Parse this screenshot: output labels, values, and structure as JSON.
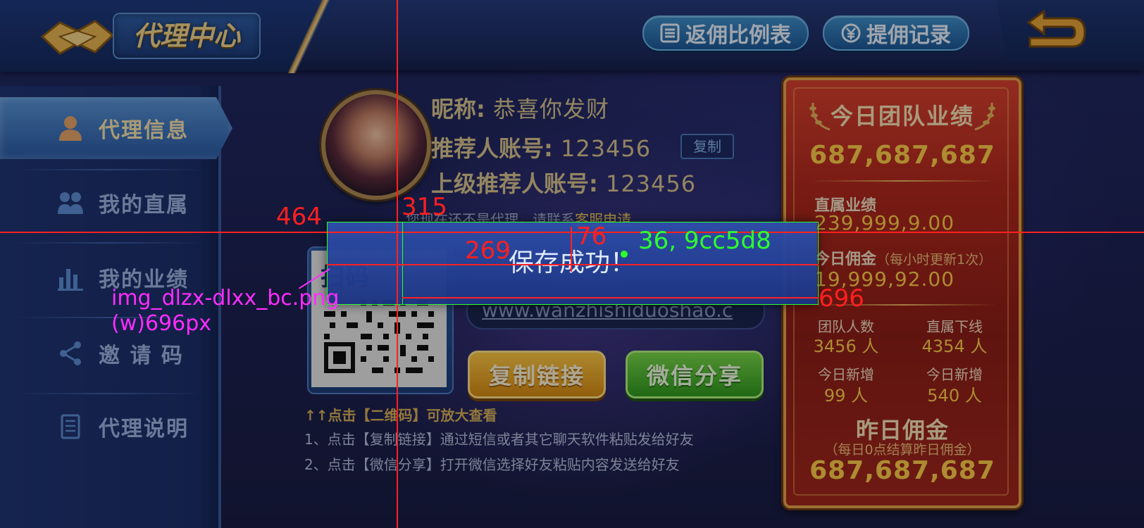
{
  "header": {
    "title": "代理中心",
    "buttons": [
      {
        "label": "返佣比例表",
        "icon": "list-icon"
      },
      {
        "label": "提佣记录",
        "icon": "yen-circle-icon"
      }
    ],
    "back_icon": "back-arrow-icon"
  },
  "sidebar": {
    "items": [
      {
        "label": "代理信息",
        "icon": "person-icon",
        "active": true
      },
      {
        "label": "我的直属",
        "icon": "group-icon",
        "active": false
      },
      {
        "label": "我的业绩",
        "icon": "bar-chart-icon",
        "active": false
      },
      {
        "label": "邀 请 码",
        "icon": "share-icon",
        "active": false
      },
      {
        "label": "代理说明",
        "icon": "document-icon",
        "active": false
      }
    ]
  },
  "profile": {
    "nickname_label": "昵称:",
    "nickname": "恭喜你发财",
    "referrer_label": "推荐人账号:",
    "referrer": "123456",
    "copy_label": "复制",
    "parent_label": "上级推荐人账号:",
    "parent": "123456"
  },
  "notice": {
    "text": "您现在还不是代理，请联系",
    "link": "客服申请"
  },
  "share": {
    "qr_label": "扫码",
    "url": "www.wanzhishiduoshao.c",
    "copy_link_label": "复制链接",
    "wechat_label": "微信分享",
    "hint_title": "↑↑点击【二维码】可放大查看",
    "hint_1": "1、点击【复制链接】通过短信或者其它聊天软件粘贴发给好友",
    "hint_2": "2、点击【微信分享】打开微信选择好友粘贴内容发送给好友"
  },
  "stats": {
    "team_title": "今日团队业绩",
    "team_value": "687,687,687",
    "direct_label": "直属业绩",
    "direct_value": "239,999,9.00",
    "commission_label": "今日佣金",
    "commission_note": "（每小时更新1次）",
    "commission_value": "19,999,92.00",
    "team_count_label": "团队人数",
    "team_count_value": "3456 人",
    "direct_down_label": "直属下线",
    "direct_down_value": "4354 人",
    "new_today_label_1": "今日新增",
    "new_today_value_1": "99 人",
    "new_today_label_2": "今日新增",
    "new_today_value_2": "540 人",
    "yesterday_title": "昨日佣金",
    "yesterday_note": "（每日0点结算昨日佣金）",
    "yesterday_value": "687,687,687"
  },
  "toast": {
    "text": "保存成功！"
  },
  "annotations": {
    "left": "464",
    "top": "315",
    "inner_x": "269",
    "inner_y": "76",
    "color_note": "36, 9cc5d8",
    "right": "696",
    "asset_name": "img_dlzx-dlxx_bc.png",
    "asset_width": "(w)696px",
    "colors": {
      "guide": "#ff2020",
      "green": "#2dff2d",
      "magenta": "#ff2cff"
    }
  },
  "colors": {
    "gold_text": "#ffcf4a",
    "panel_red": "#b2291e",
    "toast_bg": "#2e4eaa"
  }
}
